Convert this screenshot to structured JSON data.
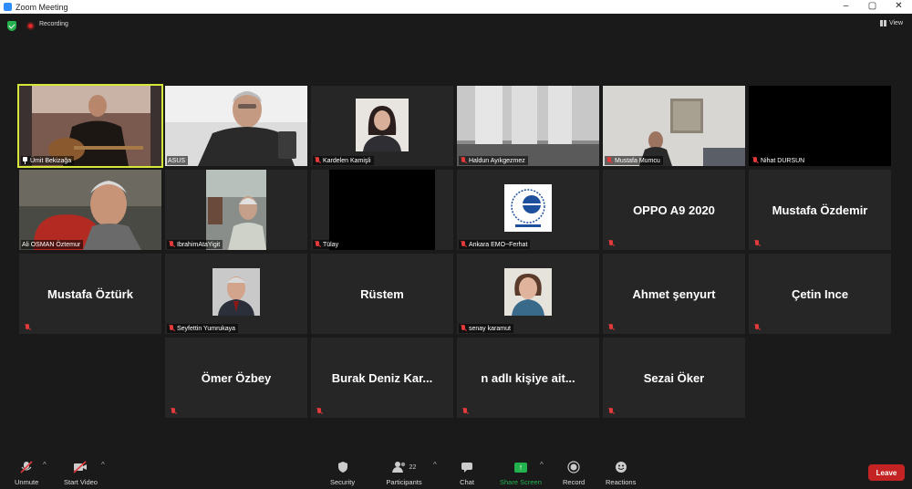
{
  "window": {
    "title": "Zoom Meeting",
    "controls": [
      "–",
      "▢",
      "✕"
    ]
  },
  "topbar": {
    "recording_label": "Recording",
    "view_label": "View"
  },
  "tiles": [
    {
      "name": "Ümit Bekizağa",
      "pinned": true
    },
    {
      "name": "ASUS"
    },
    {
      "name": "Kardelen Kamişli"
    },
    {
      "name": "Haldun Ayıkgezmez"
    },
    {
      "name": "Mustafa Mumcu"
    },
    {
      "name": "Nihat DURSUN"
    },
    {
      "name": "Ali OSMAN Öztemur"
    },
    {
      "name": "IbrahimAtaYigit"
    },
    {
      "name": "Tülay"
    },
    {
      "name": "Ankara EMO~Ferhat"
    },
    {
      "name": "OPPO A9 2020"
    },
    {
      "name": "Mustafa Özdemir"
    },
    {
      "name": "Mustafa Öztürk"
    },
    {
      "name": "Seyfettin Yumrukaya"
    },
    {
      "name": "Rüstem"
    },
    {
      "name": "senay karamut"
    },
    {
      "name": "Ahmet şenyurt"
    },
    {
      "name": "Çetin Ince"
    },
    {
      "name": "Ömer Özbey"
    },
    {
      "name": "Burak  Deniz Kar..."
    },
    {
      "name": "n adlı kişiye ait..."
    },
    {
      "name": "Sezai Öker"
    }
  ],
  "toolbar": {
    "unmute": "Unmute",
    "start_video": "Start Video",
    "security": "Security",
    "participants": "Participants",
    "participants_count": "22",
    "chat": "Chat",
    "share_screen": "Share Screen",
    "record": "Record",
    "reactions": "Reactions",
    "leave": "Leave"
  },
  "colors": {
    "active_speaker": "#d6e73a",
    "share": "#23b14d",
    "leave": "#c42323",
    "muted": "#e23a3a"
  }
}
